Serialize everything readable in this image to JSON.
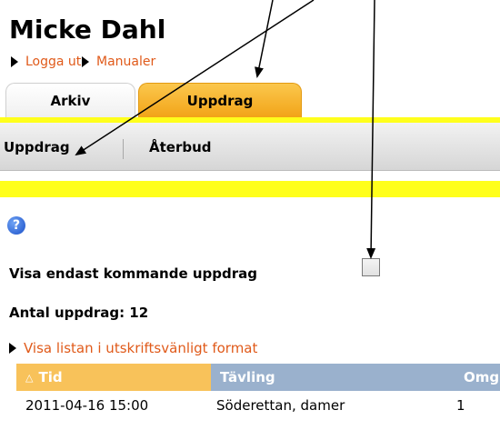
{
  "user": {
    "name": "Micke Dahl"
  },
  "top_links": {
    "logout": "Logga ut",
    "manuals": "Manualer"
  },
  "tabs": {
    "archive": "Arkiv",
    "assignments": "Uppdrag"
  },
  "subnav": {
    "assignments": "Uppdrag",
    "cancellations": "Återbud"
  },
  "help": {
    "glyph": "?"
  },
  "filter": {
    "label": "Visa endast kommande uppdrag",
    "checked": false
  },
  "summary": {
    "count_label": "Antal uppdrag: 12"
  },
  "print_link": "Visa listan i utskriftsvänligt format",
  "table": {
    "columns": {
      "time": "Tid",
      "competition": "Tävling",
      "round": "Omg"
    },
    "sort_glyph": "△",
    "rows": [
      {
        "time": "2011-04-16 15:00",
        "competition": "Söderettan, damer",
        "round": "1"
      }
    ]
  },
  "colors": {
    "accent_orange": "#f2a418",
    "link_orange": "#e05a1a",
    "highlight_yellow": "#ffff1c",
    "table_header_blue": "#9ab1cd"
  }
}
